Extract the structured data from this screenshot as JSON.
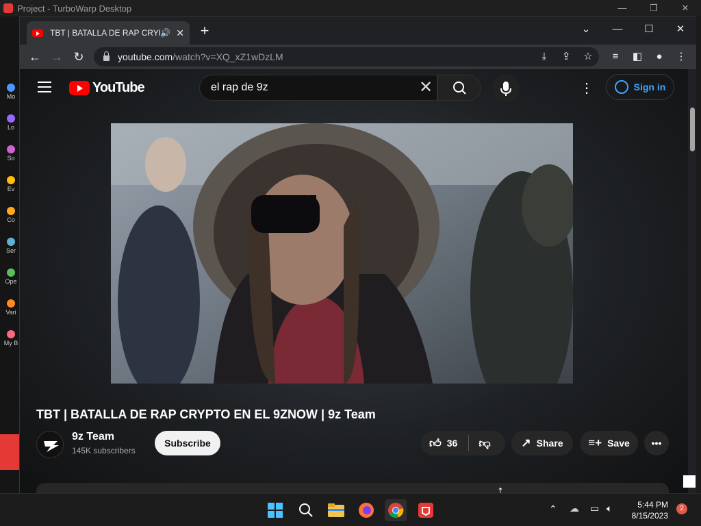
{
  "turbowarp": {
    "title": "Project - TurboWarp Desktop",
    "categories": [
      {
        "label": "Mo",
        "color": "#4c97ff"
      },
      {
        "label": "Lo",
        "color": "#9966ff"
      },
      {
        "label": "So",
        "color": "#cf63cf"
      },
      {
        "label": "Ev",
        "color": "#ffbf00"
      },
      {
        "label": "Co",
        "color": "#ffab19"
      },
      {
        "label": "Ser",
        "color": "#5cb1d6"
      },
      {
        "label": "Ope",
        "color": "#59c059"
      },
      {
        "label": "Vari",
        "color": "#ff8c1a"
      },
      {
        "label": "My B",
        "color": "#ff6680"
      }
    ]
  },
  "chrome": {
    "tab_title": "TBT | BATALLA DE RAP CRYPT",
    "url_host": "youtube.com",
    "url_path": "/watch?v=XQ_xZ1wDzLM"
  },
  "youtube": {
    "logo_text": "YouTube",
    "search_query": "el rap de 9z",
    "sign_in": "Sign in",
    "video_title": "TBT | BATALLA DE RAP CRYPTO EN EL 9ZNOW | 9z Team",
    "channel_name": "9z Team",
    "subscribers": "145K subscribers",
    "subscribe_label": "Subscribe",
    "likes": "36",
    "share_label": "Share",
    "save_label": "Save"
  },
  "taskbar": {
    "time": "5:44 PM",
    "date": "8/15/2023",
    "notifications": "2"
  }
}
